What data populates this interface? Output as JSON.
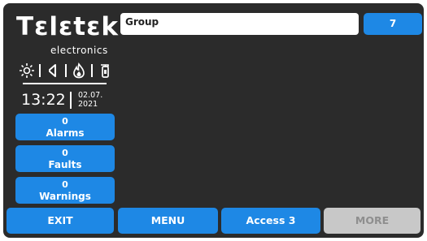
{
  "brand": {
    "logo_text": "Tεlεtεk",
    "tagline": "electronics"
  },
  "status_icons": [
    "sun-icon",
    "speaker-icon",
    "fire-icon",
    "extinguisher-icon"
  ],
  "clock": {
    "time": "13:22",
    "date_line1": "02.07.",
    "date_line2": "2021"
  },
  "counters": [
    {
      "count": "0",
      "label": "Alarms"
    },
    {
      "count": "0",
      "label": "Faults"
    },
    {
      "count": "0",
      "label": "Warnings"
    }
  ],
  "topbar": {
    "field_label": "Group",
    "group_number": "7"
  },
  "bottom_buttons": {
    "exit": "EXIT",
    "menu": "MENU",
    "access": "Access 3",
    "more": "MORE"
  },
  "colors": {
    "background": "#2b2b2b",
    "accent": "#1e88e5",
    "disabled": "#c8c8c8"
  }
}
